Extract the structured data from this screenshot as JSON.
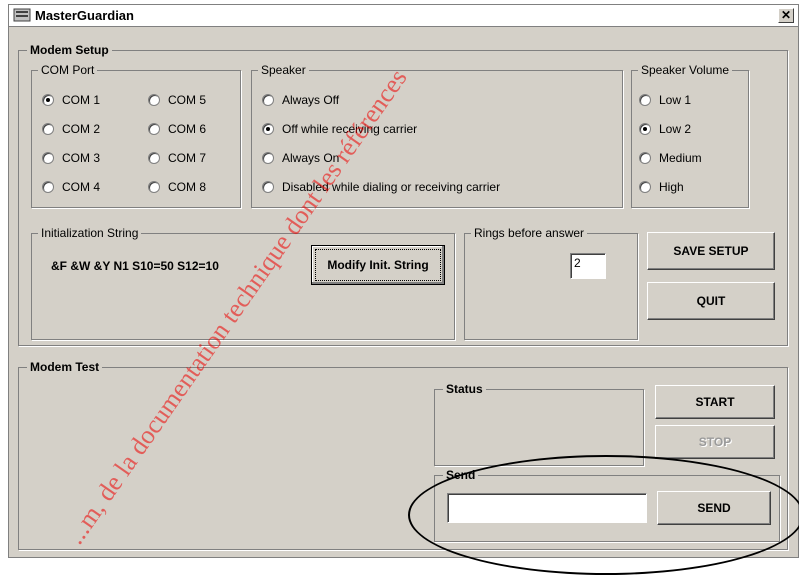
{
  "window": {
    "title": "MasterGuardian",
    "close_label": "✕"
  },
  "modem_setup": {
    "label": "Modem Setup",
    "com_port": {
      "label": "COM Port",
      "options": [
        "COM 1",
        "COM 2",
        "COM 3",
        "COM 4",
        "COM 5",
        "COM 6",
        "COM 7",
        "COM 8"
      ],
      "selected": "COM 1"
    },
    "speaker": {
      "label": "Speaker",
      "options": [
        "Always Off",
        "Off while receiving carrier",
        "Always On",
        "Disabled while dialing or receiving carrier"
      ],
      "selected": "Off while receiving carrier"
    },
    "speaker_volume": {
      "label": "Speaker Volume",
      "options": [
        "Low 1",
        "Low 2",
        "Medium",
        "High"
      ],
      "selected": "Low 2"
    },
    "init_string": {
      "label": "Initialization String",
      "value": "&F &W &Y N1 S10=50 S12=10",
      "modify_button": "Modify Init. String"
    },
    "rings": {
      "label": "Rings before answer",
      "value": "2"
    },
    "save_button": "SAVE SETUP",
    "quit_button": "QUIT"
  },
  "modem_test": {
    "label": "Modem Test",
    "status_label": "Status",
    "status_text": "",
    "start_button": "START",
    "stop_button": "STOP",
    "send_label": "Send",
    "send_value": "",
    "send_button": "SEND"
  },
  "overlay": {
    "watermark": "...m, de la documentation technique dont les références"
  }
}
